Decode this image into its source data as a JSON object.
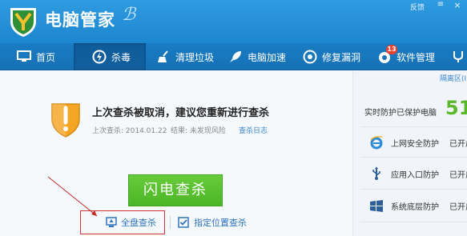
{
  "window": {
    "title": "电脑管家",
    "title_mark": "ℬ",
    "feedback": "反馈",
    "menu_icon": "≡",
    "close_icon": "×"
  },
  "nav": {
    "items": [
      {
        "label": "首页",
        "icon": "monitor-icon"
      },
      {
        "label": "杀毒",
        "icon": "virus-scan-icon",
        "active": true
      },
      {
        "label": "清理垃圾",
        "icon": "broom-icon"
      },
      {
        "label": "电脑加速",
        "icon": "rocket-icon"
      },
      {
        "label": "修复漏洞",
        "icon": "repair-icon"
      },
      {
        "label": "软件管理",
        "icon": "software-icon"
      },
      {
        "label": "",
        "icon": "stethoscope-icon"
      }
    ],
    "software_badge": "13"
  },
  "scan": {
    "headline": "上次查杀被取消，建议您重新进行查杀",
    "last_scan": "上次查杀: 2014.01.22",
    "result": "结果: 未发现风险",
    "log_link": "查杀日志",
    "flash_button": "闪电查杀",
    "full_scan": "全盘查杀",
    "custom_scan": "指定位置查杀"
  },
  "protection": {
    "quarantine": "隔离区(I",
    "label": "实时防护已保护电脑",
    "count": "51",
    "rows": [
      {
        "label": "上网安全防护",
        "status": "已开启",
        "icon": "ie-icon"
      },
      {
        "label": "应用入口防护",
        "status": "已开启",
        "icon": "usb-icon"
      },
      {
        "label": "系统底层防护",
        "status": "已开启",
        "icon": "windows-icon"
      }
    ]
  },
  "colors": {
    "accent": "#1c86cf",
    "nav": "#1671b5",
    "green": "#5ab829",
    "link": "#2e74c0",
    "highlight": "#d03434"
  }
}
